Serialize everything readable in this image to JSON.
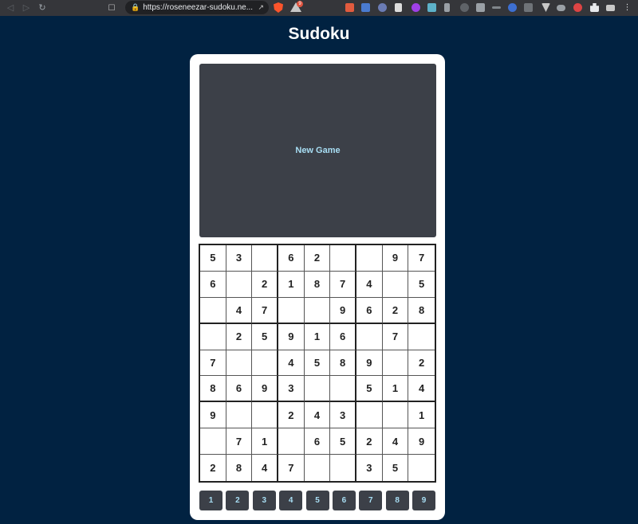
{
  "browser": {
    "url": "https://roseneezar-sudoku.ne...",
    "rewards_badge": "9"
  },
  "page": {
    "title": "Sudoku",
    "new_game_label": "New Game"
  },
  "board": [
    [
      "5",
      "3",
      "",
      "6",
      "2",
      "",
      "",
      "9",
      "7"
    ],
    [
      "6",
      "",
      "2",
      "1",
      "8",
      "7",
      "4",
      "",
      "5"
    ],
    [
      "",
      "4",
      "7",
      "",
      "",
      "9",
      "6",
      "2",
      "8"
    ],
    [
      "",
      "2",
      "5",
      "9",
      "1",
      "6",
      "",
      "7",
      ""
    ],
    [
      "7",
      "",
      "",
      "4",
      "5",
      "8",
      "9",
      "",
      "2"
    ],
    [
      "8",
      "6",
      "9",
      "3",
      "",
      "",
      "5",
      "1",
      "4"
    ],
    [
      "9",
      "",
      "",
      "2",
      "4",
      "3",
      "",
      "",
      "1"
    ],
    [
      "",
      "7",
      "1",
      "",
      "6",
      "5",
      "2",
      "4",
      "9"
    ],
    [
      "2",
      "8",
      "4",
      "7",
      "",
      "",
      "3",
      "5",
      ""
    ]
  ],
  "numpad": [
    "1",
    "2",
    "3",
    "4",
    "5",
    "6",
    "7",
    "8",
    "9"
  ],
  "colors": {
    "background": "#012241",
    "button": "#3c4048",
    "button_text": "#a8def4"
  }
}
